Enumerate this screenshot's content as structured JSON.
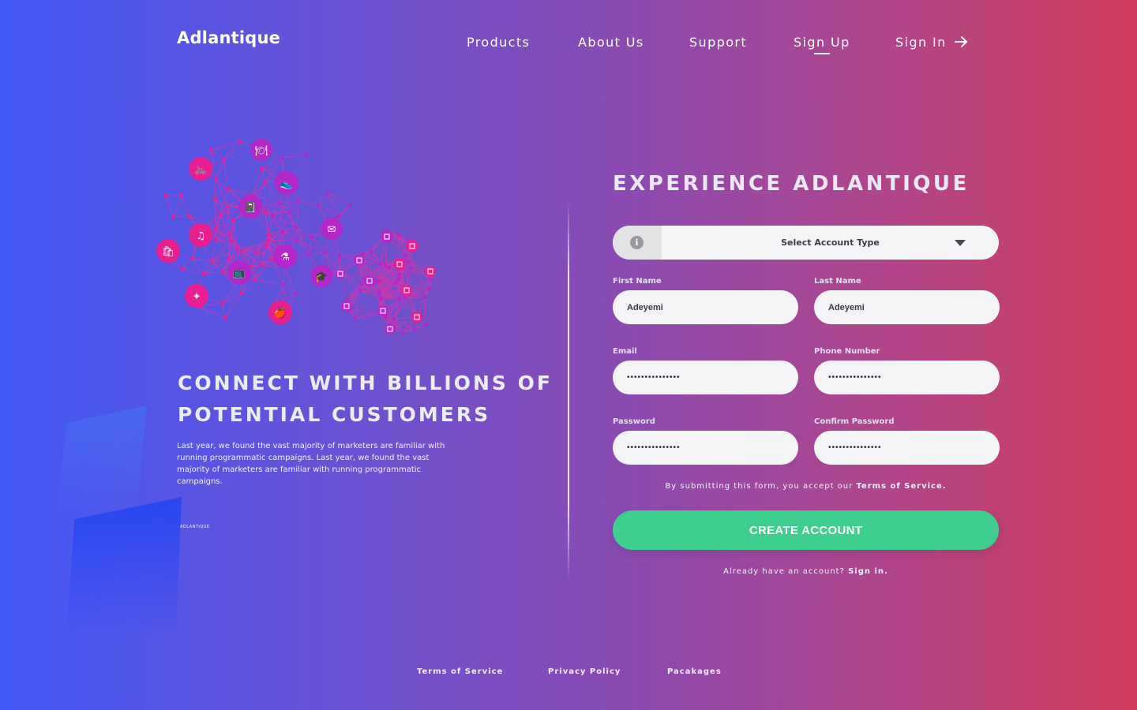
{
  "brand": {
    "logo": "Adlantique",
    "small_mark": "ADLANTIQUE"
  },
  "nav": {
    "products": "Products",
    "about": "About Us",
    "support": "Support",
    "signup": "Sign Up",
    "signin": "Sign In"
  },
  "hero": {
    "headline_line1": "CONNECT WITH  BILLIONS OF",
    "headline_line2": "POTENTIAL CUSTOMERS",
    "body": "Last year, we found the vast majority of marketers are familiar with running programmatic campaigns. Last year, we found the vast majority of marketers are familiar with running programmatic campaigns."
  },
  "form": {
    "title": "EXPERIENCE  ADLANTIQUE",
    "account_type": "Select Account Type",
    "first_name": {
      "label": "First Name",
      "value": "Adeyemi"
    },
    "last_name": {
      "label": "Last Name",
      "value": "Adeyemi"
    },
    "email": {
      "label": "Email",
      "value": "•••••••••••••••"
    },
    "phone": {
      "label": "Phone Number",
      "value": "•••••••••••••••"
    },
    "password": {
      "label": "Password",
      "value": "•••••••••••••••"
    },
    "confirm_password": {
      "label": "Confirm Password",
      "value": "•••••••••••••••"
    },
    "terms_prefix": "By submitting this form, you accept our ",
    "terms_link": "Terms of Service.",
    "submit": "CREATE ACCOUNT",
    "signin_prefix": "Already have an account? ",
    "signin_link": "Sign in."
  },
  "footer": {
    "terms": "Terms of Service",
    "privacy": "Privacy Policy",
    "packages": "Pacakages"
  },
  "colors": {
    "gradient_left": "#4159f7",
    "gradient_right": "#d13d5b",
    "button": "#3ecf8e",
    "node_pink": "#e8208f",
    "node_purple": "#b427c9"
  },
  "icons": [
    "info-icon",
    "caret-down-icon",
    "arrow-right-icon",
    "dining-icon",
    "bicycle-icon",
    "shoe-icon",
    "notebook-icon",
    "music-icon",
    "email-icon",
    "shopping-bag-icon",
    "lab-flask-icon",
    "tv-icon",
    "graduation-cap-icon",
    "kayak-icon",
    "apple-icon"
  ]
}
